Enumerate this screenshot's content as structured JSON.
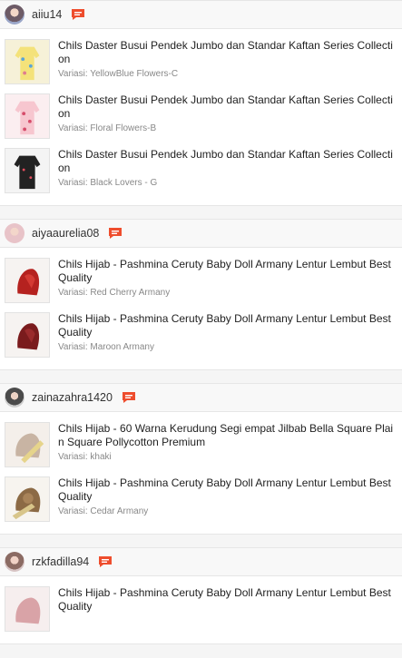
{
  "groups": [
    {
      "username": "aiiu14",
      "products": [
        {
          "name": "Chils Daster Busui Pendek Jumbo dan Standar Kaftan Series Collection",
          "variant": "Variasi: YellowBlue Flowers-C",
          "thumb": "yellow-floral-dress"
        },
        {
          "name": "Chils Daster Busui Pendek Jumbo dan Standar Kaftan Series Collection",
          "variant": "Variasi: Floral Flowers-B",
          "thumb": "pink-floral-dress"
        },
        {
          "name": "Chils Daster Busui Pendek Jumbo dan Standar Kaftan Series Collection",
          "variant": "Variasi: Black Lovers - G",
          "thumb": "black-dress"
        }
      ]
    },
    {
      "username": "aiyaaurelia08",
      "products": [
        {
          "name": "Chils Hijab - Pashmina Ceruty Baby Doll Armany Lentur Lembut Best Quality",
          "variant": "Variasi: Red Cherry Armany",
          "thumb": "red-hijab"
        },
        {
          "name": "Chils Hijab - Pashmina Ceruty Baby Doll Armany Lentur Lembut Best Quality",
          "variant": "Variasi: Maroon Armany",
          "thumb": "maroon-hijab"
        }
      ]
    },
    {
      "username": "zainazahra1420",
      "products": [
        {
          "name": "Chils Hijab - 60 Warna Kerudung Segi empat Jilbab Bella Square Plain Square Pollycotton Premium",
          "variant": "Variasi: khaki",
          "thumb": "khaki-hijab"
        },
        {
          "name": "Chils Hijab - Pashmina Ceruty Baby Doll Armany Lentur Lembut Best Quality",
          "variant": "Variasi: Cedar Armany",
          "thumb": "cedar-hijab"
        }
      ]
    },
    {
      "username": "rzkfadilla94",
      "products": [
        {
          "name": "Chils Hijab - Pashmina Ceruty Baby Doll Armany Lentur Lembut Best Quality",
          "variant": "",
          "thumb": "pink-hijab"
        }
      ]
    }
  ],
  "colors": {
    "chat_icon": "#ee4d2d"
  }
}
